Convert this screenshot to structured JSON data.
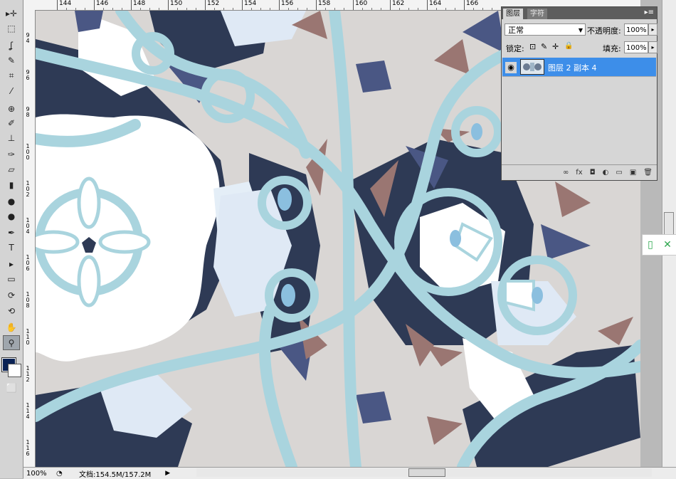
{
  "ruler": {
    "top_labels": [
      "144",
      "146",
      "148",
      "150",
      "152",
      "154",
      "156",
      "158",
      "160",
      "162",
      "164",
      "166"
    ],
    "left_labels": [
      "94",
      "96",
      "98",
      "100",
      "102",
      "104",
      "106",
      "108",
      "110",
      "112",
      "114",
      "116"
    ]
  },
  "tools": [
    "move-tool-icon",
    "marquee-tool-icon",
    "lasso-tool-icon",
    "quick-select-tool-icon",
    "crop-tool-icon",
    "eyedropper-tool-icon",
    "healing-brush-tool-icon",
    "brush-tool-icon",
    "clone-stamp-tool-icon",
    "history-brush-tool-icon",
    "eraser-tool-icon",
    "gradient-tool-icon",
    "blur-tool-icon",
    "dodge-tool-icon",
    "pen-tool-icon",
    "type-tool-icon",
    "path-select-tool-icon",
    "rectangle-tool-icon",
    "3d-rotate-tool-icon",
    "3d-orbit-tool-icon",
    "hand-tool-icon",
    "zoom-tool-icon"
  ],
  "tool_glyphs": [
    "▸✛",
    "⬚",
    "ʆ",
    "✎",
    "⌗",
    "⁄",
    "⊕",
    "✐",
    "⊥",
    "✑",
    "▱",
    "▮",
    "●",
    "●",
    "✒",
    "T",
    "▸",
    "▭",
    "⟳",
    "⟲",
    "✋",
    "⚲"
  ],
  "colors": {
    "foreground": "#0b2355",
    "background": "#ffffff"
  },
  "layers_panel": {
    "tab_layers": "图层",
    "tab_character": "字符",
    "blend_mode": "正常",
    "opacity_label": "不透明度:",
    "opacity_value": "100%",
    "lock_label": "锁定:",
    "fill_label": "填充:",
    "fill_value": "100%",
    "layers": [
      {
        "name": "图层 2 副本 4",
        "visible": true,
        "selected": true
      }
    ]
  },
  "status": {
    "zoom": "100%",
    "doc_info": "文档:154.5M/157.2M"
  }
}
